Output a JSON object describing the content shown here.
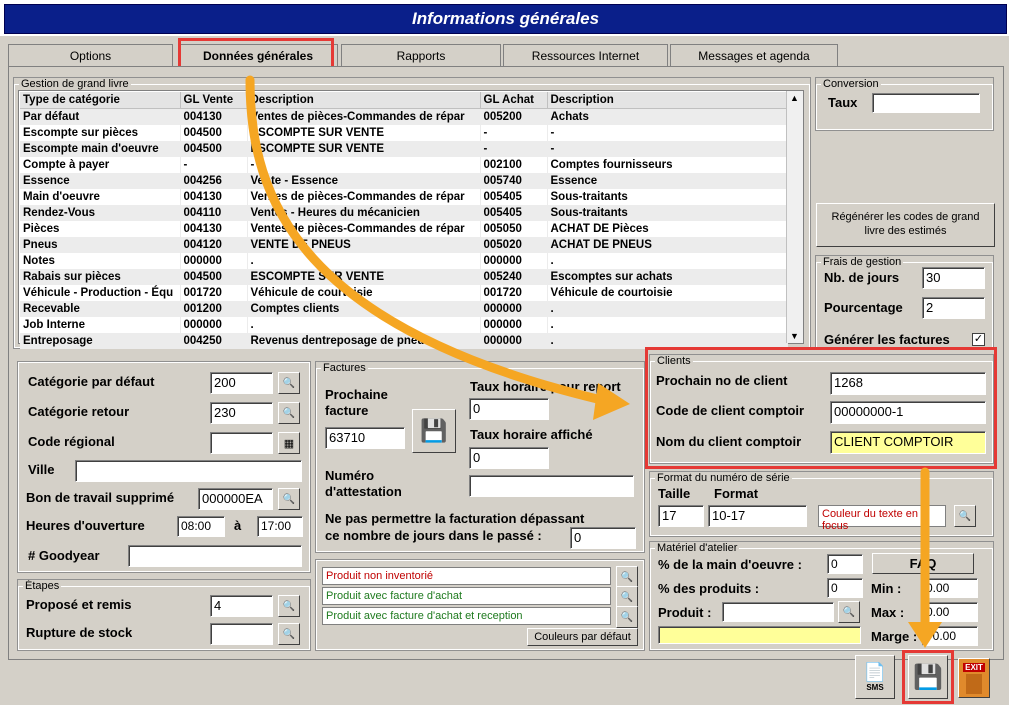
{
  "window": {
    "title": "Informations générales"
  },
  "tabs": [
    "Options",
    "Données générales",
    "Rapports",
    "Ressources Internet",
    "Messages et agenda"
  ],
  "ledger": {
    "legend": "Gestion de grand livre",
    "columns": [
      "Type de catégorie",
      "GL Vente",
      "Description",
      "GL Achat",
      "Description"
    ],
    "rows": [
      [
        "Par défaut",
        "004130",
        "Ventes de pièces-Commandes de répar",
        "005200",
        "Achats"
      ],
      [
        "Escompte sur pièces",
        "004500",
        "ESCOMPTE SUR VENTE",
        "-",
        "-"
      ],
      [
        "Escompte main d'oeuvre",
        "004500",
        "ESCOMPTE SUR VENTE",
        "-",
        "-"
      ],
      [
        "Compte à payer",
        "-",
        "-",
        "002100",
        "Comptes fournisseurs"
      ],
      [
        "Essence",
        "004256",
        "Vente - Essence",
        "005740",
        "Essence"
      ],
      [
        "Main d'oeuvre",
        "004130",
        "Ventes de pièces-Commandes de répar",
        "005405",
        "Sous-traitants"
      ],
      [
        "Rendez-Vous",
        "004110",
        "Ventes - Heures du mécanicien",
        "005405",
        "Sous-traitants"
      ],
      [
        "Pièces",
        "004130",
        "Ventes de pièces-Commandes de répar",
        "005050",
        "ACHAT DE Pièces"
      ],
      [
        "Pneus",
        "004120",
        "VENTE DE PNEUS",
        "005020",
        "ACHAT DE PNEUS"
      ],
      [
        "Notes",
        "000000",
        ".",
        "000000",
        "."
      ],
      [
        "Rabais sur pièces",
        "004500",
        "ESCOMPTE SUR VENTE",
        "005240",
        "Escomptes sur achats"
      ],
      [
        "Véhicule - Production - Équ",
        "001720",
        "Véhicule de courtoisie",
        "001720",
        "Véhicule de courtoisie"
      ],
      [
        "Recevable",
        "001200",
        "Comptes clients",
        "000000",
        "."
      ],
      [
        "Job Interne",
        "000000",
        ".",
        "000000",
        "."
      ],
      [
        "Entreposage",
        "004250",
        "Revenus dentreposage de pneus",
        "000000",
        "."
      ]
    ]
  },
  "conversion": {
    "legend": "Conversion",
    "taux_label": "Taux",
    "taux_value": ""
  },
  "regen_button": "Régénérer les codes de grand livre des estimés",
  "frais": {
    "legend": "Frais de gestion",
    "jours_label": "Nb. de jours",
    "jours_value": "30",
    "pct_label": "Pourcentage",
    "pct_value": "2",
    "generer_label": "Générer les factures",
    "generer_checked": "✓"
  },
  "general": {
    "cat_defaut_label": "Catégorie par défaut",
    "cat_defaut_value": "200",
    "cat_retour_label": "Catégorie retour",
    "cat_retour_value": "230",
    "code_regional_label": "Code régional",
    "code_regional_value": "",
    "ville_label": "Ville",
    "ville_value": "",
    "bon_label": "Bon de travail supprimé",
    "bon_value": "000000EA",
    "heures_label": "Heures d'ouverture",
    "heures_from": "08:00",
    "heures_a": "à",
    "heures_to": "17:00",
    "goodyear_label": "# Goodyear",
    "goodyear_value": ""
  },
  "etapes": {
    "legend": "Étapes",
    "propose_label": "Proposé et remis",
    "propose_value": "4",
    "rupture_label": "Rupture de stock",
    "rupture_value": ""
  },
  "factures": {
    "legend": "Factures",
    "prochaine_label_1": "Prochaine",
    "prochaine_label_2": "facture",
    "prochaine_value": "63710",
    "taux_report_label": "Taux horaire pour report",
    "taux_report_value": "0",
    "taux_affiche_label": "Taux horaire affiché",
    "taux_affiche_value": "0",
    "attestation_label_1": "Numéro",
    "attestation_label_2": "d'attestation",
    "attestation_value": "",
    "depasse_label_1": "Ne pas permettre la facturation dépassant",
    "depasse_label_2": "ce nombre de jours dans le passé :",
    "depasse_value": "0"
  },
  "couleurs": {
    "non_inventorie": "Produit non inventorié",
    "facture_achat": "Produit avec facture d'achat",
    "facture_reception": "Produit avec facture d'achat et reception",
    "defaut_button": "Couleurs par défaut",
    "red": "#c00000",
    "green": "#1e7a1e"
  },
  "clients": {
    "legend": "Clients",
    "prochain_label": "Prochain no de client",
    "prochain_value": "1268",
    "code_label": "Code de client comptoir",
    "code_value": "00000000-1",
    "nom_label": "Nom du client comptoir",
    "nom_value": "CLIENT COMPTOIR"
  },
  "serie": {
    "legend": "Format du numéro de série",
    "taille_label": "Taille",
    "taille_value": "17",
    "format_label": "Format",
    "format_value": "10-17",
    "couleur_label": "Couleur du texte en focus"
  },
  "atelier": {
    "legend": "Matériel d'atelier",
    "main_oeuvre_label": "% de la main d'oeuvre :",
    "main_oeuvre_value": "0",
    "produits_label": "% des produits :",
    "produits_value": "0",
    "produit_label": "Produit :",
    "produit_value": "",
    "faq_button": "FAQ",
    "min_label": "Min :",
    "min_value": "0.00",
    "max_label": "Max :",
    "max_value": "0.00",
    "marge_label": "Marge :",
    "marge_value": "70.00"
  },
  "bottom": {
    "sms": "SMS",
    "exit": "EXIT"
  },
  "accent": {
    "highlight": "#e53935",
    "arrow": "#f5a623",
    "title_bg": "#0a1f8a"
  }
}
